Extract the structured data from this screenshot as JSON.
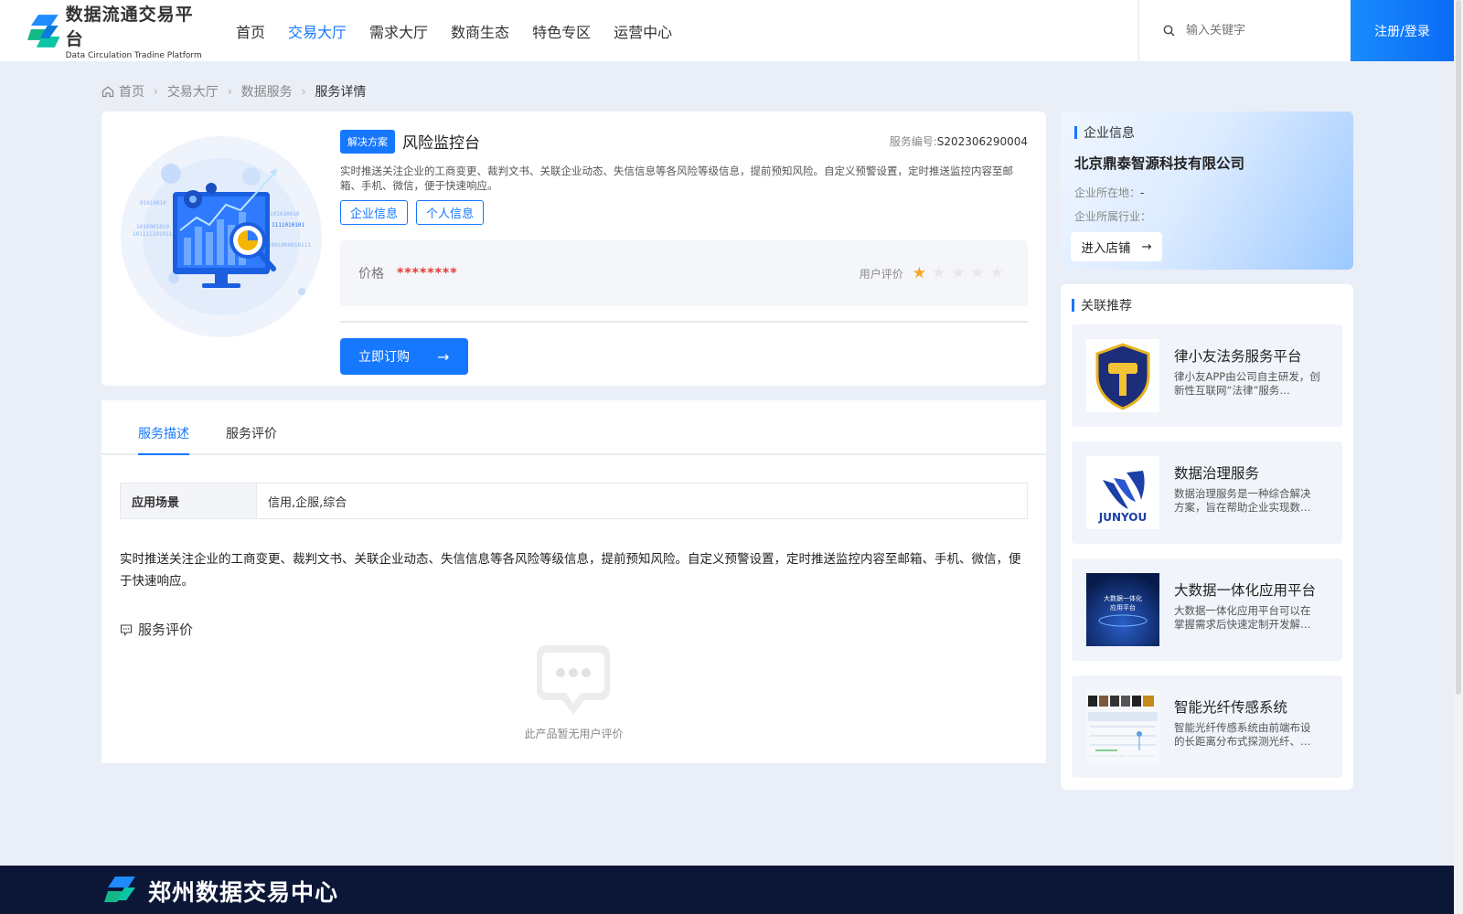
{
  "header": {
    "logo_title": "数据流通交易平台",
    "logo_sub": "Data Circulation Tradine Platform",
    "nav": [
      {
        "label": "首页",
        "active": false
      },
      {
        "label": "交易大厅",
        "active": true
      },
      {
        "label": "需求大厅",
        "active": false
      },
      {
        "label": "数商生态",
        "active": false
      },
      {
        "label": "特色专区",
        "active": false
      },
      {
        "label": "运营中心",
        "active": false
      }
    ],
    "search_placeholder": "输入关键字",
    "login_label": "注册/登录"
  },
  "breadcrumb": [
    "首页",
    "交易大厅",
    "数据服务",
    "服务详情"
  ],
  "product": {
    "tag": "解决方案",
    "title": "风险监控台",
    "service_no_label": "服务编号:",
    "service_no": "S202306290004",
    "description": "实时推送关注企业的工商变更、裁判文书、关联企业动态、失信信息等各风险等级信息，提前预知风险。自定义预警设置，定时推送监控内容至邮箱、手机、微信，便于快速响应。",
    "tags": [
      "企业信息",
      "个人信息"
    ],
    "price_label": "价格",
    "price_value": "********",
    "rating_label": "用户评价",
    "rating": 1,
    "rating_max": 5,
    "buy_label": "立即订购"
  },
  "detail": {
    "tabs": [
      {
        "label": "服务描述",
        "active": true
      },
      {
        "label": "服务评价",
        "active": false
      }
    ],
    "scene_label": "应用场景",
    "scene_value": "信用,企服,综合",
    "long_description": "实时推送关注企业的工商变更、裁判文书、关联企业动态、失信信息等各风险等级信息，提前预知风险。自定义预警设置，定时推送监控内容至邮箱、手机、微信，便于快速响应。",
    "review_title": "服务评价",
    "empty_review": "此产品暂无用户评价"
  },
  "company": {
    "section_title": "企业信息",
    "name": "北京鼎泰智源科技有限公司",
    "location_label": "企业所在地：",
    "location_value": "-",
    "industry_label": "企业所属行业：",
    "industry_value": "",
    "shop_label": "进入店铺"
  },
  "related": {
    "section_title": "关联推荐",
    "items": [
      {
        "name": "律小友法务服务平台",
        "desc": "律小友APP由公司自主研发，创新性互联网“法律”服务…",
        "thumb": "gavel-shield-icon"
      },
      {
        "name": "数据治理服务",
        "desc": "数据治理服务是一种综合解决方案，旨在帮助企业实现数…",
        "thumb": "junyou-logo",
        "thumb_text": "JUNYOU"
      },
      {
        "name": "大数据一体化应用平台",
        "desc": "大数据一体化应用平台可以在掌握需求后快速定制开发解…",
        "thumb": "bigdata-banner",
        "thumb_text": "大数据一体化\n应用平台"
      },
      {
        "name": "智能光纤传感系统",
        "desc": "智能光纤传感系统由前端布设的长距离分布式探测光纤、…",
        "thumb": "fiber-dashboard"
      }
    ]
  },
  "footer": {
    "title": "郑州数据交易中心"
  },
  "colors": {
    "accent": "#1677ff",
    "price": "#e53935",
    "star": "#f5a623",
    "footer_bg": "#0c1738"
  }
}
